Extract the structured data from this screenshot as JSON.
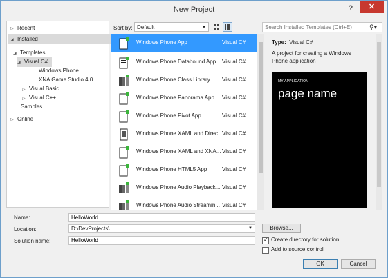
{
  "window": {
    "title": "New Project",
    "help_label": "?",
    "close_label": "✕"
  },
  "tree": {
    "items": [
      {
        "label": "Recent",
        "expander": "▷"
      },
      {
        "label": "Installed",
        "expander": "◢"
      },
      {
        "label": "Templates",
        "expander": "◢"
      },
      {
        "label": "Visual C#",
        "expander": "◢"
      },
      {
        "label": "Windows Phone",
        "expander": ""
      },
      {
        "label": "XNA Game Studio 4.0",
        "expander": ""
      },
      {
        "label": "Visual Basic",
        "expander": "▷"
      },
      {
        "label": "Visual C++",
        "expander": "▷"
      },
      {
        "label": "Samples",
        "expander": ""
      },
      {
        "label": "Online",
        "expander": "▷"
      }
    ]
  },
  "toolbar": {
    "sort_label": "Sort by:",
    "sort_value": "Default",
    "search_placeholder": "Search Installed Templates (Ctrl+E)",
    "search_icon": "search-icon",
    "search_dropdown": "▾"
  },
  "templates": [
    {
      "name": "Windows Phone App",
      "lang": "Visual C#",
      "icon": "phone-app-icon"
    },
    {
      "name": "Windows Phone Databound App",
      "lang": "Visual C#",
      "icon": "phone-databound-icon"
    },
    {
      "name": "Windows Phone Class Library",
      "lang": "Visual C#",
      "icon": "class-library-icon"
    },
    {
      "name": "Windows Phone Panorama App",
      "lang": "Visual C#",
      "icon": "panorama-icon"
    },
    {
      "name": "Windows Phone Pivot App",
      "lang": "Visual C#",
      "icon": "pivot-icon"
    },
    {
      "name": "Windows Phone XAML and Direc...",
      "lang": "Visual C#",
      "icon": "xaml-direct3d-icon"
    },
    {
      "name": "Windows Phone XAML and XNA...",
      "lang": "Visual C#",
      "icon": "xaml-xna-icon"
    },
    {
      "name": "Windows Phone HTML5 App",
      "lang": "Visual C#",
      "icon": "html5-icon"
    },
    {
      "name": "Windows Phone Audio Playback...",
      "lang": "Visual C#",
      "icon": "audio-playback-icon"
    },
    {
      "name": "Windows Phone Audio Streamin...",
      "lang": "Visual C#",
      "icon": "audio-streaming-icon"
    }
  ],
  "details": {
    "type_label": "Type:",
    "type_value": "Visual C#",
    "description": "A project for creating a Windows Phone application",
    "preview_app": "MY APPLICATION",
    "preview_page": "page name"
  },
  "form": {
    "name_label": "Name:",
    "name_value": "HelloWorld",
    "location_label": "Location:",
    "location_value": "D:\\DevProjects\\",
    "solution_label": "Solution name:",
    "solution_value": "HelloWorld",
    "browse_label": "Browse...",
    "create_dir_label": "Create directory for solution",
    "create_dir_checked": "✓",
    "source_control_label": "Add to source control",
    "ok_label": "OK",
    "cancel_label": "Cancel"
  },
  "colors": {
    "selection": "#3399ff",
    "close": "#c7382f",
    "accent_icon": "#3bb53b"
  }
}
